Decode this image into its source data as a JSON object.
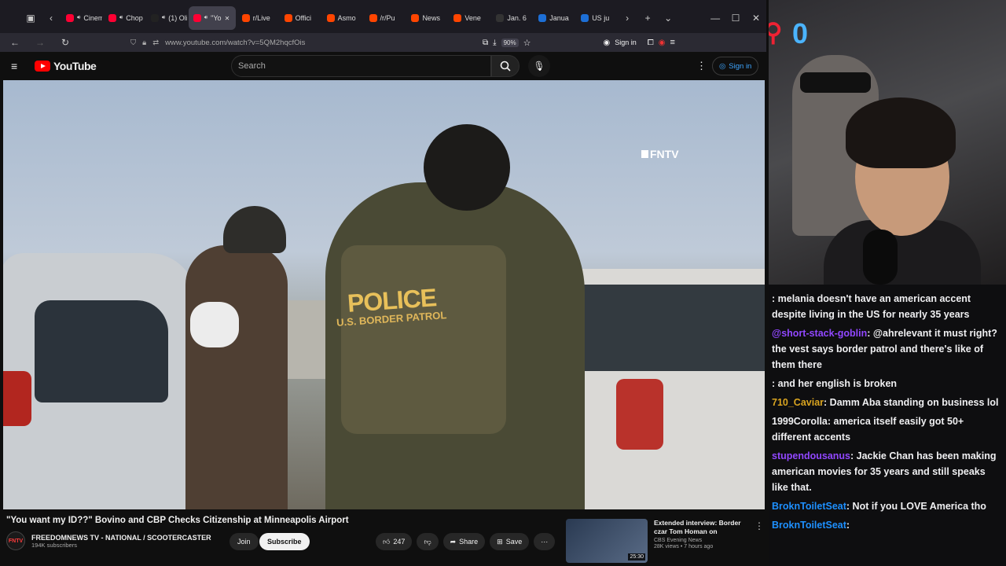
{
  "browser": {
    "tabs": [
      {
        "label": "Cinem",
        "color": "#ff0033"
      },
      {
        "label": "Chop",
        "color": "#ff0033"
      },
      {
        "label": "(1) Oli",
        "color": "#222"
      },
      {
        "label": "\"Yo",
        "color": "#ff0033",
        "active": true
      },
      {
        "label": "r/Live",
        "color": "#ff4500"
      },
      {
        "label": "Offici",
        "color": "#ff4500"
      },
      {
        "label": "Asmo",
        "color": "#ff4500"
      },
      {
        "label": "/r/Pu",
        "color": "#ff4500"
      },
      {
        "label": "News",
        "color": "#ff4500"
      },
      {
        "label": "Vene",
        "color": "#ff4500"
      },
      {
        "label": "Jan. 6",
        "color": "#333"
      },
      {
        "label": "Janua",
        "color": "#1d6fd6"
      },
      {
        "label": "US ju",
        "color": "#1d6fd6"
      }
    ],
    "url": "www.youtube.com/watch?v=5QM2hqcfOis",
    "zoom": "90%",
    "signin": "Sign in"
  },
  "youtube": {
    "logo_text": "YouTube",
    "search_placeholder": "Search",
    "signin": "Sign in",
    "video_watermark": "FNTV",
    "video_title": "\"You want my ID??\" Bovino and CBP Checks Citizenship at Minneapolis Airport",
    "channel_name": "FREEDOMNEWS TV - NATIONAL / SCOOTERCASTER",
    "channel_avatar": "FNTV",
    "subscribers": "194K subscribers",
    "join": "Join",
    "subscribe": "Subscribe",
    "likes": "247",
    "share": "Share",
    "save": "Save",
    "recommended": {
      "title": "Extended interview: Border czar Tom Homan on Minneapolis I...",
      "channel": "CBS Evening News",
      "meta": "28K views • 7 hours ago",
      "duration": "25:30"
    }
  },
  "stream": {
    "counter": "0"
  },
  "chat": [
    {
      "user": "",
      "color": "#efeff1",
      "text": ": melania doesn't have an american accent despite living in the US for nearly 35 years"
    },
    {
      "user": "@short-stack-goblin",
      "color": "#9147ff",
      "text": ": @ahrelevant it must right? the vest says border patrol and there's like of them there"
    },
    {
      "user": "",
      "color": "#efeff1",
      "text": ": and her english is broken"
    },
    {
      "user": "710_Caviar",
      "color": "#daa520",
      "text": ": Damm Aba standing on business lol"
    },
    {
      "user": "1999Corolla",
      "color": "#efeff1",
      "text": ": america itself easily got 50+ different accents"
    },
    {
      "user": "stupendousanus",
      "color": "#9147ff",
      "text": ": Jackie Chan has been making american movies for 35 years and still speaks like that."
    },
    {
      "user": "BroknToiletSeat",
      "color": "#1e90ff",
      "text": ": Not if you LOVE America tho"
    },
    {
      "user": "BroknToiletSeat",
      "color": "#1e90ff",
      "text": ":"
    }
  ]
}
